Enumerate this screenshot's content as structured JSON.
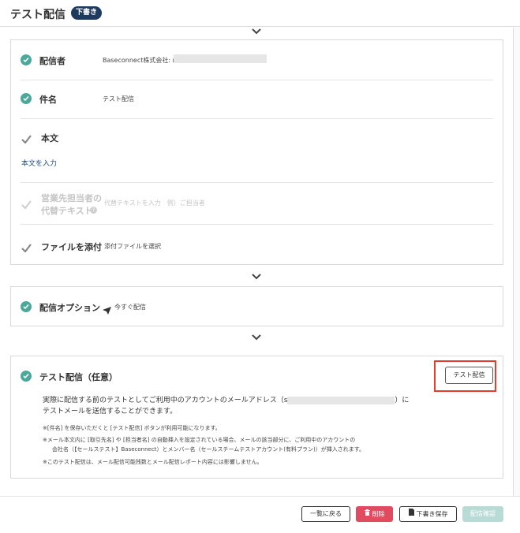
{
  "header": {
    "title": "テスト配信",
    "badge": "下書き"
  },
  "sections": {
    "sender": {
      "label": "配信者",
      "value": "Baseconnect株式会社: r"
    },
    "subject": {
      "label": "件名",
      "value": "テスト配信"
    },
    "body": {
      "label": "本文",
      "link": "本文を入力"
    },
    "alt_text": {
      "label_line1": "営業先担当者の",
      "label_line2": "代替テキスト",
      "help_icon": "?",
      "placeholder": "代替テキストを入力　例）ご担当者"
    },
    "attachment": {
      "label": "ファイルを添付",
      "link": "添付ファイルを選択"
    }
  },
  "options": {
    "label": "配信オプション",
    "value": "今すぐ配信"
  },
  "test_send": {
    "label": "テスト配信（任意）",
    "button": "テスト配信",
    "desc_part1": "実際に配信する前のテストとしてご利用中のアカウントのメールアドレス（s",
    "desc_part2": "）に",
    "desc_line2": "テストメールを送信することができます。",
    "note1": "※[件名] を保存いただくと [テスト配信] ボタンが利用可能になります。",
    "note2_line1": "※メール本文内に [取引先名] や [担当者名] の自動挿入を設定されている場合、メールの該当部分に、ご利用中のアカウントの",
    "note2_line2": "会社名（【セールステスト】Baseconnect）とメンバー名（セールスチームテストアカウント(有料プラン)）が挿入されます。",
    "note3": "※このテスト配信は、メール配信可能残数とメール配信レポート内容には影響しません。"
  },
  "footer": {
    "back": "一覧に戻る",
    "delete": "削除",
    "save_draft": "下書き保存",
    "confirm": "配信確認"
  },
  "colors": {
    "accent": "#4ca89a",
    "badge": "#1e3a5f",
    "danger": "#e24a60",
    "highlight": "#e23d2d",
    "link": "#1d4a7a"
  }
}
